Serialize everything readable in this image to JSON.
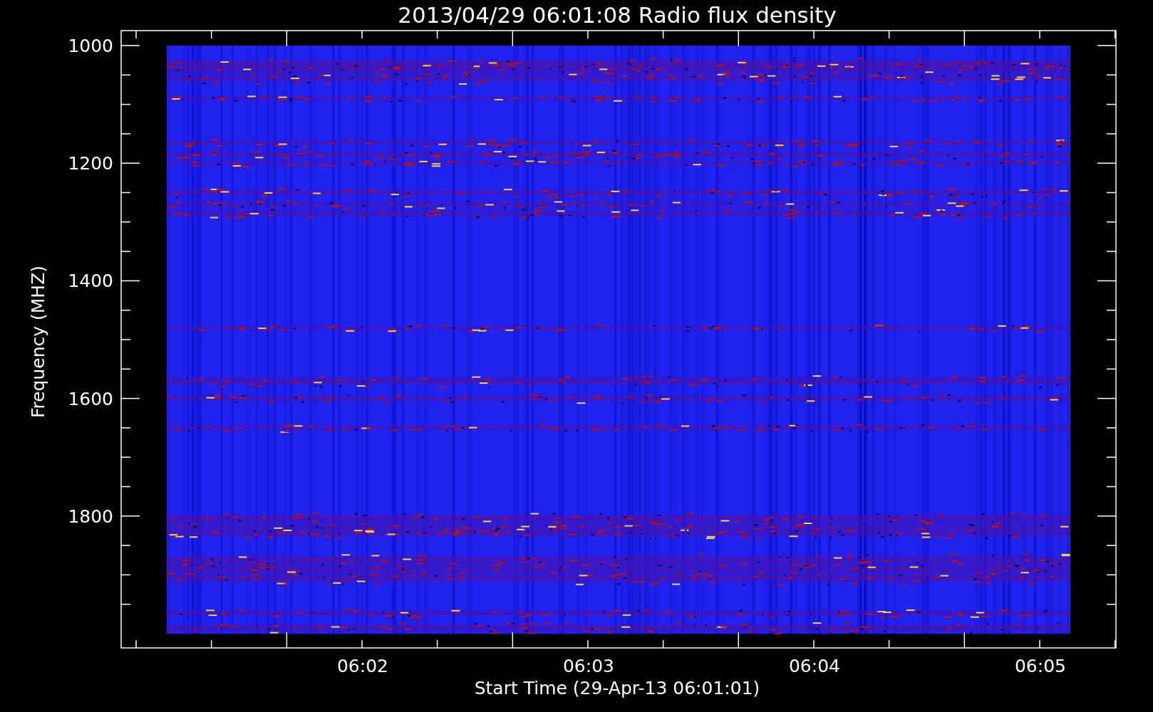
{
  "chart": {
    "title": "2013/04/29 06:01:08 Radio flux density",
    "ylabel": "Frequency (MHZ)",
    "xlabel": "Start Time (29-Apr-13 06:01:01)",
    "yticks": [
      "1000",
      "1200",
      "1400",
      "1600",
      "1800"
    ],
    "xticks": [
      "06:02",
      "06:03",
      "06:04",
      "06:05"
    ]
  }
}
